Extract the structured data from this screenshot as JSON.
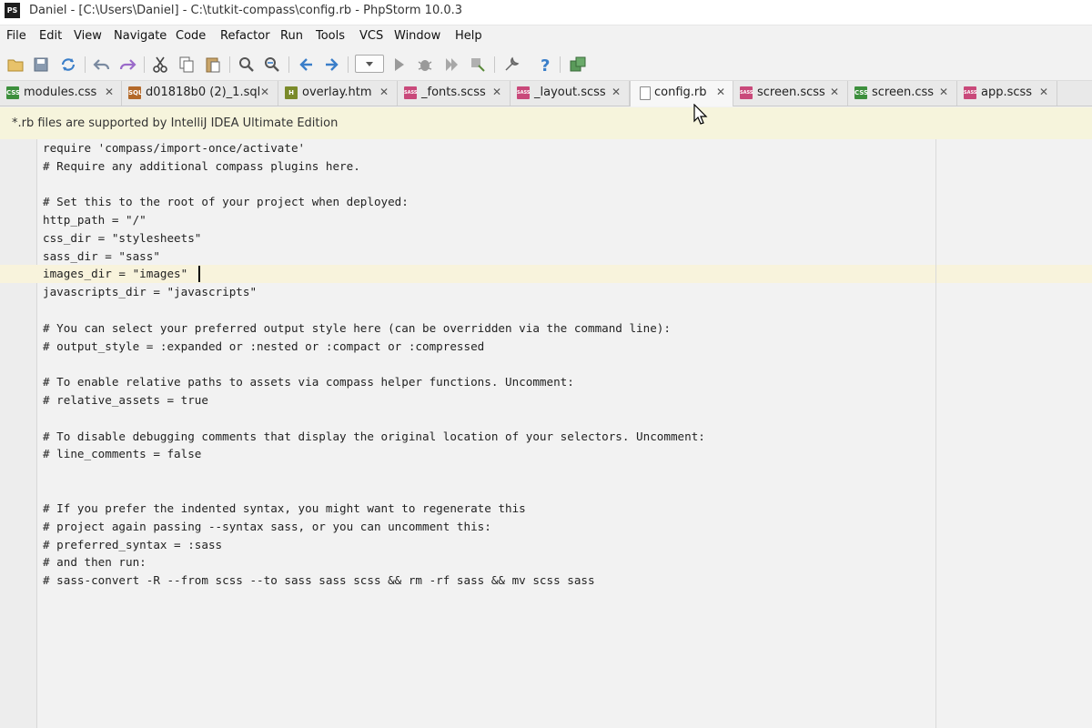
{
  "window": {
    "app_icon_text": "PS",
    "title": "Daniel - [C:\\Users\\Daniel] - C:\\tutkit-compass\\config.rb - PhpStorm 10.0.3"
  },
  "menu": {
    "items": [
      {
        "label": "File"
      },
      {
        "label": "Edit"
      },
      {
        "label": "View"
      },
      {
        "label": "Navigate"
      },
      {
        "label": "Code"
      },
      {
        "label": "Refactor"
      },
      {
        "label": "Run"
      },
      {
        "label": "Tools"
      },
      {
        "label": "VCS"
      },
      {
        "label": "Window"
      },
      {
        "label": "Help"
      }
    ]
  },
  "toolbar": {
    "icons": [
      "open-folder-icon",
      "save-all-icon",
      "synchronize-icon",
      "undo-icon",
      "redo-icon",
      "cut-icon",
      "copy-icon",
      "paste-icon",
      "find-icon",
      "replace-icon",
      "back-icon",
      "forward-icon",
      "run-configurations-dropdown",
      "run-icon",
      "debug-icon",
      "coverage-icon",
      "stop-icon",
      "settings-icon",
      "help-icon",
      "structure-icon"
    ]
  },
  "tabs": [
    {
      "label": "modules.css",
      "icon": "css-file-icon",
      "icon_text": "CSS",
      "icon_color": "#3d8f3d",
      "active": false
    },
    {
      "label": "d01818b0 (2)_1.sql",
      "icon": "sql-file-icon",
      "icon_text": "SQL",
      "icon_color": "#b3692a",
      "active": false
    },
    {
      "label": "overlay.htm",
      "icon": "html-file-icon",
      "icon_text": "H",
      "icon_color": "#7a8a2a",
      "active": false
    },
    {
      "label": "_fonts.scss",
      "icon": "sass-file-icon",
      "icon_text": "SASS",
      "icon_color": "#c9497a",
      "active": false
    },
    {
      "label": "_layout.scss",
      "icon": "sass-file-icon",
      "icon_text": "SASS",
      "icon_color": "#c9497a",
      "active": false
    },
    {
      "label": "config.rb",
      "icon": "ruby-file-icon",
      "icon_text": "",
      "icon_color": "#8a8a8a",
      "active": true
    },
    {
      "label": "screen.scss",
      "icon": "sass-file-icon",
      "icon_text": "SASS",
      "icon_color": "#c9497a",
      "active": false
    },
    {
      "label": "screen.css",
      "icon": "css-file-icon",
      "icon_text": "CSS",
      "icon_color": "#3d8f3d",
      "active": false
    },
    {
      "label": "app.scss",
      "icon": "sass-file-icon",
      "icon_text": "SASS",
      "icon_color": "#c9497a",
      "active": false
    }
  ],
  "notice": {
    "text": "*.rb files are supported by IntelliJ IDEA Ultimate Edition"
  },
  "editor": {
    "lines": [
      "require 'compass/import-once/activate'",
      "# Require any additional compass plugins here.",
      "",
      "# Set this to the root of your project when deployed:",
      "http_path = \"/\"",
      "css_dir = \"stylesheets\"",
      "sass_dir = \"sass\"",
      "images_dir = \"images\"",
      "javascripts_dir = \"javascripts\"",
      "",
      "# You can select your preferred output style here (can be overridden via the command line):",
      "# output_style = :expanded or :nested or :compact or :compressed",
      "",
      "# To enable relative paths to assets via compass helper functions. Uncomment:",
      "# relative_assets = true",
      "",
      "# To disable debugging comments that display the original location of your selectors. Uncomment:",
      "# line_comments = false",
      "",
      "",
      "# If you prefer the indented syntax, you might want to regenerate this",
      "# project again passing --syntax sass, or you can uncomment this:",
      "# preferred_syntax = :sass",
      "# and then run:",
      "# sass-convert -R --from scss --to sass sass scss && rm -rf sass && mv scss sass"
    ]
  }
}
